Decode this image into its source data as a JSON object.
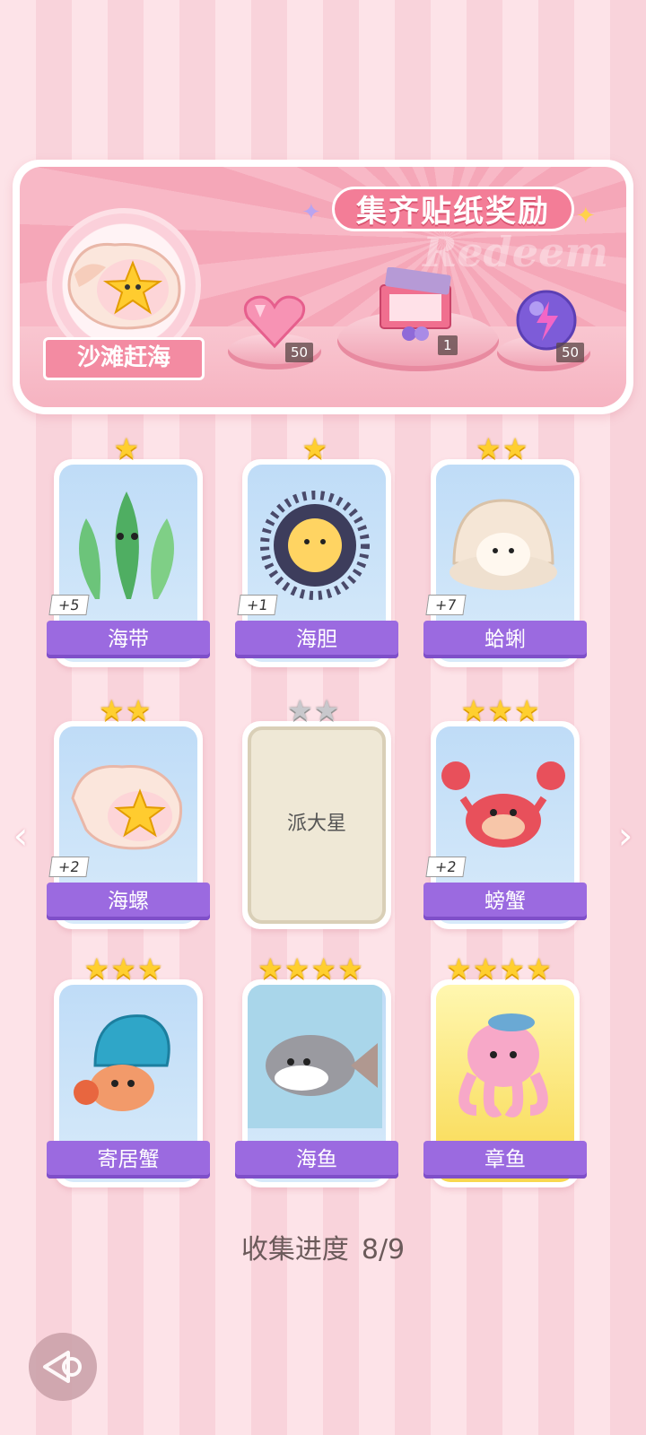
{
  "banner": {
    "title": "集齐贴纸奖励",
    "watermark": "Redeem",
    "scene_label": "沙滩赶海",
    "rewards": [
      {
        "icon": "pink-heart-gem-icon",
        "count": "50"
      },
      {
        "icon": "gift-box-icon",
        "count": "1"
      },
      {
        "icon": "lightning-orb-icon",
        "count": "50"
      }
    ]
  },
  "cards": [
    {
      "name": "海带",
      "stars": 1,
      "bonus": "+5",
      "collected": true
    },
    {
      "name": "海胆",
      "stars": 1,
      "bonus": "+1",
      "collected": true
    },
    {
      "name": "蛤蜊",
      "stars": 2,
      "bonus": "+7",
      "collected": true
    },
    {
      "name": "海螺",
      "stars": 2,
      "bonus": "+2",
      "collected": true
    },
    {
      "name": "派大星",
      "stars": 2,
      "bonus": "",
      "collected": false
    },
    {
      "name": "螃蟹",
      "stars": 3,
      "bonus": "+2",
      "collected": true
    },
    {
      "name": "寄居蟹",
      "stars": 3,
      "bonus": "",
      "collected": true
    },
    {
      "name": "海鱼",
      "stars": 4,
      "bonus": "",
      "collected": true
    },
    {
      "name": "章鱼",
      "stars": 4,
      "bonus": "",
      "collected": true
    }
  ],
  "progress": {
    "label": "收集进度",
    "value": "8/9"
  },
  "colors": {
    "accent": "#9b6ae0",
    "banner": "#f37d97",
    "star": "#ffcf2f"
  }
}
